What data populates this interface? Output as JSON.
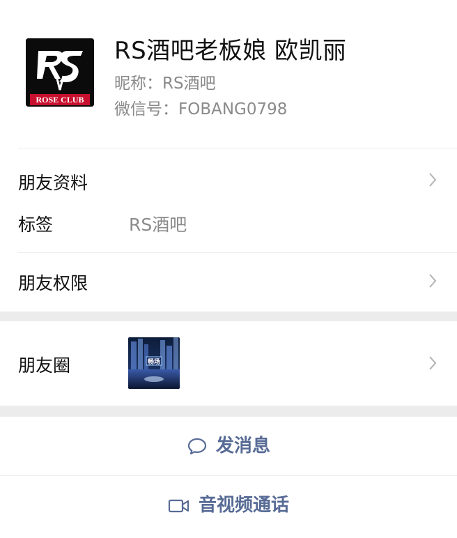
{
  "profile": {
    "display_name": "RS酒吧老板娘 欧凯丽",
    "nickname": "昵称：RS酒吧",
    "wechat_id": "微信号：FOBANG0798",
    "avatar_logo_text": "RS",
    "avatar_club_text": "ROSE CLUB"
  },
  "rows": {
    "friend_info": "朋友资料",
    "tags_label": "标签",
    "tags_value": "RS酒吧",
    "permissions": "朋友权限",
    "moments": "朋友圈"
  },
  "moments_thumb_text": "畅场",
  "actions": {
    "message": "发消息",
    "av_call": "音视频通话"
  },
  "colors": {
    "link": "#576b95",
    "secondary_text": "#8a8a8a",
    "separator": "#ececec",
    "avatar_red": "#c8102e"
  }
}
